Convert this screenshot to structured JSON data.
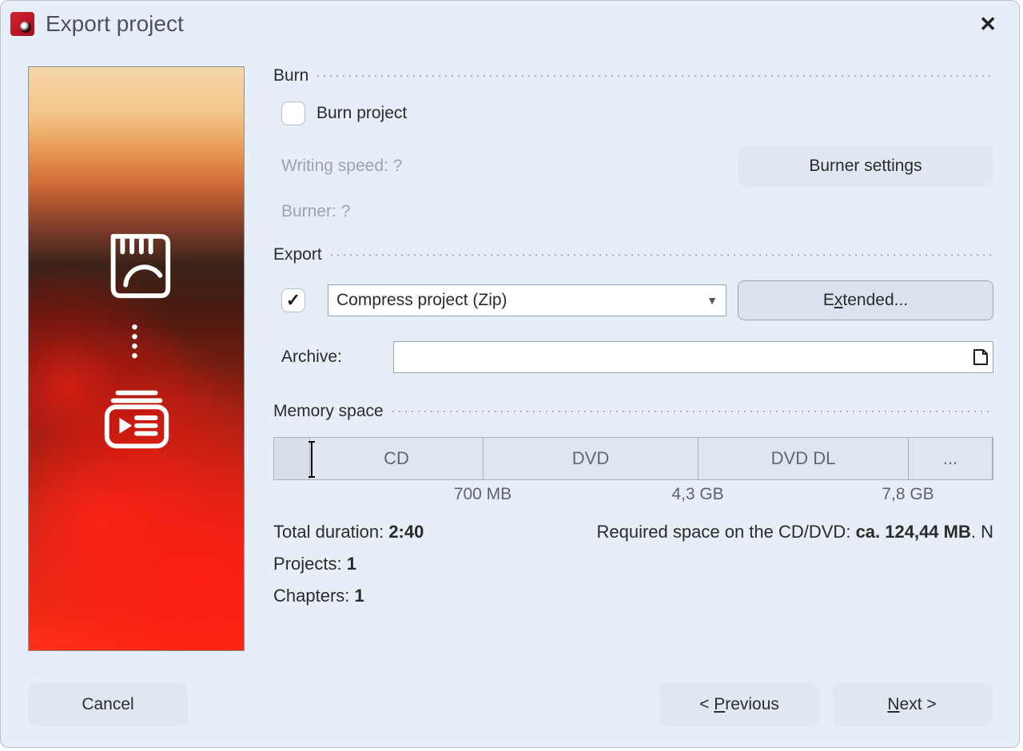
{
  "window": {
    "title": "Export project"
  },
  "sections": {
    "burn": {
      "label": "Burn",
      "burn_project": "Burn project",
      "writing_speed_label": "Writing speed: ?",
      "burner_label": "Burner: ?",
      "burner_settings": "Burner settings"
    },
    "export": {
      "label": "Export",
      "compress_option": "Compress project (Zip)",
      "extended_pre": "E",
      "extended_u": "x",
      "extended_post": "tended...",
      "archive_label": "Archive:",
      "archive_value": ""
    },
    "memory": {
      "label": "Memory space",
      "cd": "CD",
      "dvd": "DVD",
      "dvddl": "DVD DL",
      "rest": "...",
      "tick_700": "700 MB",
      "tick_43": "4,3 GB",
      "tick_78": "7,8 GB"
    }
  },
  "stats": {
    "duration_label": "Total duration: ",
    "duration_value": "2:40",
    "projects_label": "Projects: ",
    "projects_value": "1",
    "chapters_label": "Chapters: ",
    "chapters_value": "1",
    "req_label": "Required space on the CD/DVD: ",
    "req_bold": "ca. 124,44 MB",
    "req_tail": ". N"
  },
  "footer": {
    "cancel": "Cancel",
    "prev_pre": "< ",
    "prev_u": "P",
    "prev_post": "revious",
    "next_u": "N",
    "next_post": "ext >"
  }
}
